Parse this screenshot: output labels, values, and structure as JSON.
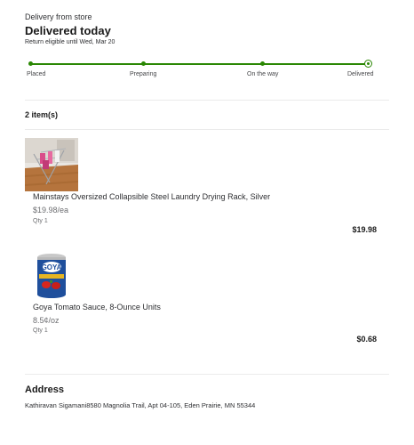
{
  "header": {
    "section_label": "Delivery from store",
    "title": "Delivered today",
    "return_note": "Return eligible until Wed, Mar 20"
  },
  "tracker": {
    "steps": [
      "Placed",
      "Preparing",
      "On the way",
      "Delivered"
    ],
    "current_step": "Delivered",
    "accent_color": "#2a8703"
  },
  "items": {
    "count_label": "2 item(s)",
    "list": [
      {
        "name": "Mainstays Oversized Collapsible Steel Laundry Drying Rack, Silver",
        "unit_price": "$19.98/ea",
        "qty": "Qty 1",
        "total": "$19.98",
        "image": "laundry-drying-rack-photo"
      },
      {
        "name": "Goya Tomato Sauce, 8-Ounce Units",
        "unit_price": "8.5¢/oz",
        "qty": "Qty 1",
        "total": "$0.68",
        "image": "goya-tomato-sauce-can-photo"
      }
    ]
  },
  "address": {
    "title": "Address",
    "text": "Kathiravan Sigamani8580 Magnolia Trail, Apt 04-105, Eden Prairie, MN 55344"
  }
}
